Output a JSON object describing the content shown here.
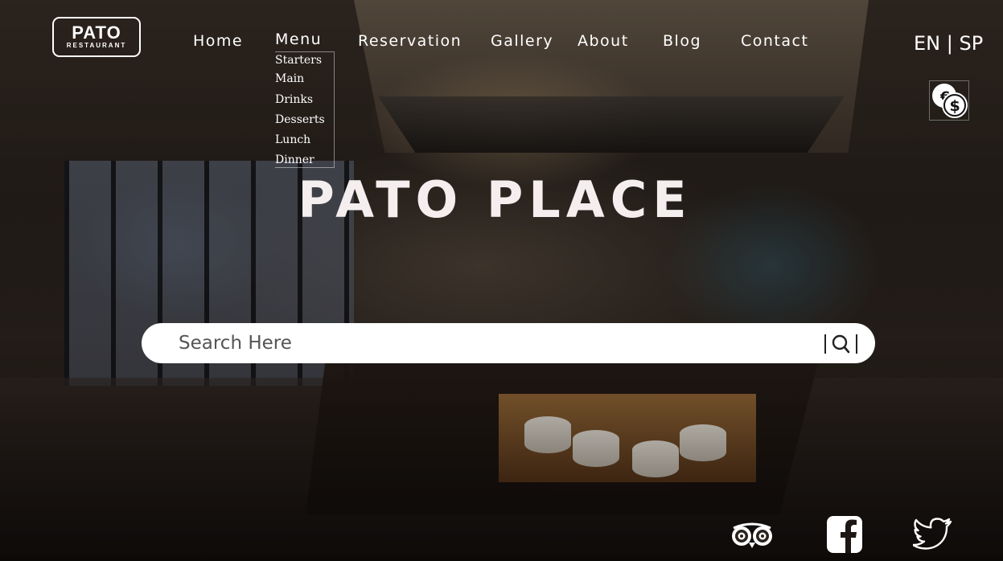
{
  "logo": {
    "title": "PATO",
    "subtitle": "RESTAURANT"
  },
  "nav": {
    "items": [
      {
        "label": "Home"
      },
      {
        "label": "Menu"
      },
      {
        "label": "Reservation"
      },
      {
        "label": "Gallery"
      },
      {
        "label": "About"
      },
      {
        "label": "Blog"
      },
      {
        "label": "Contact"
      }
    ],
    "menu_dropdown": [
      "Starters",
      "Main",
      "Drinks",
      "Desserts",
      "Lunch",
      "Dinner"
    ]
  },
  "language": {
    "en": "EN",
    "separator": "|",
    "sp": "SP"
  },
  "currency": {
    "icon": "currency-euro-dollar-icon"
  },
  "hero": {
    "title": "PATO PLACE"
  },
  "search": {
    "placeholder": "Search Here",
    "icon": "search-icon"
  },
  "social": {
    "icons": [
      "tripadvisor-icon",
      "facebook-icon",
      "twitter-icon"
    ]
  }
}
